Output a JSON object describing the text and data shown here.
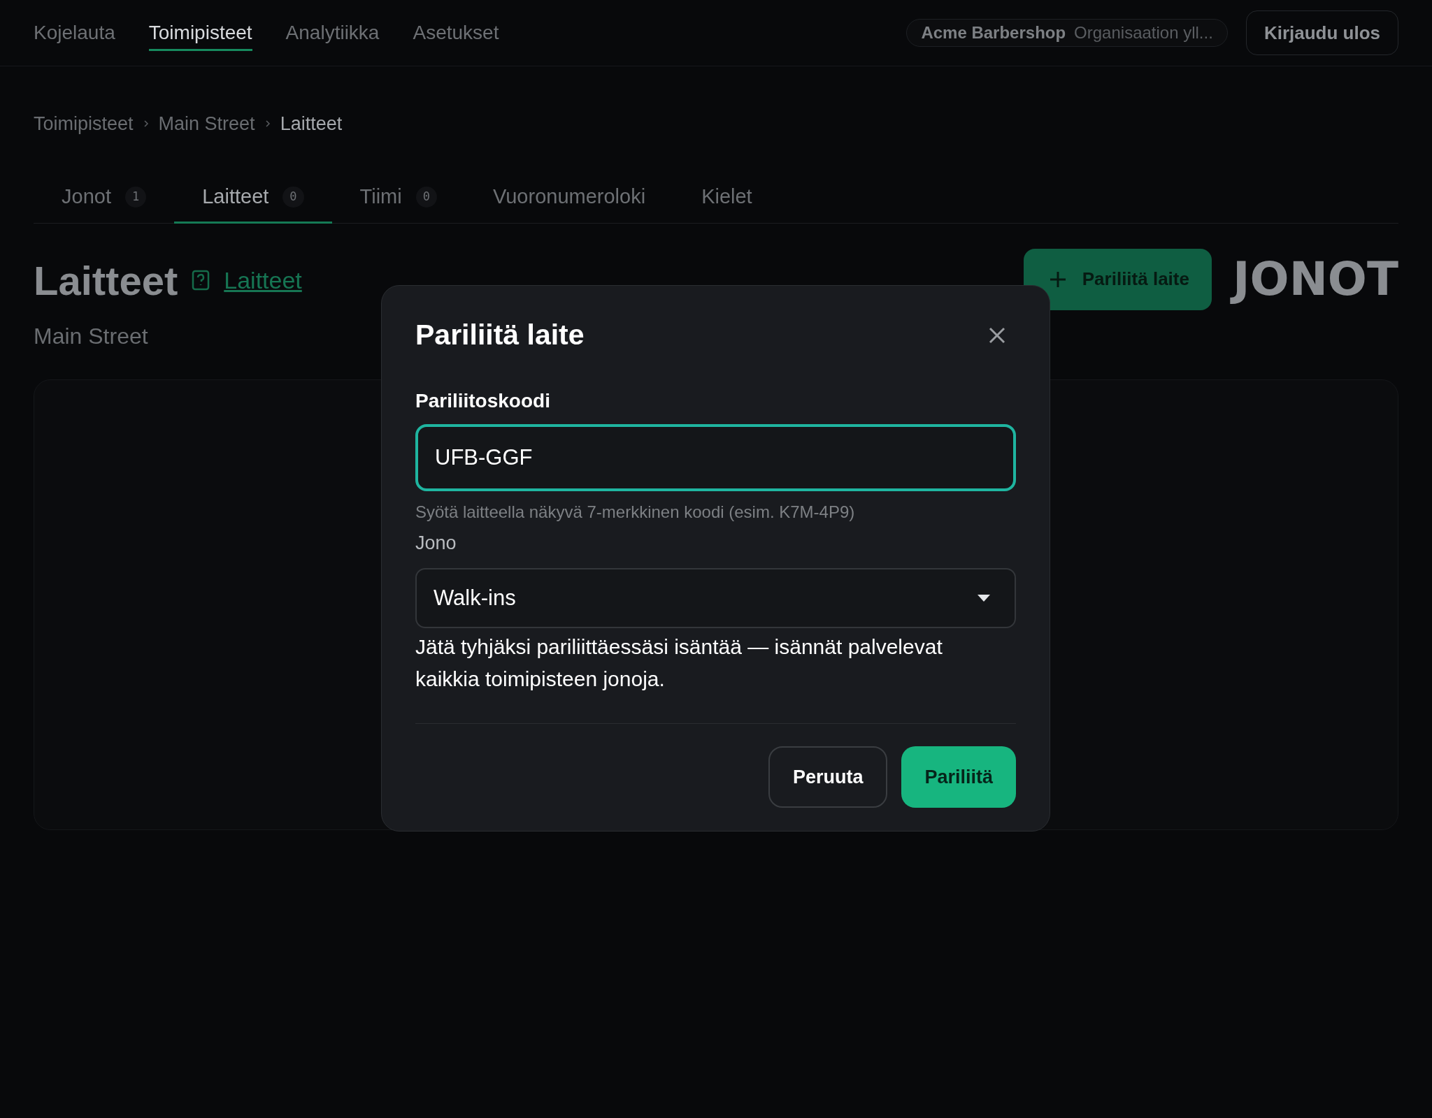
{
  "nav": {
    "items": [
      {
        "label": "Kojelauta",
        "selected": false
      },
      {
        "label": "Toimipisteet",
        "selected": true
      },
      {
        "label": "Analytiikka",
        "selected": false
      },
      {
        "label": "Asetukset",
        "selected": false
      }
    ],
    "org": {
      "name": "Acme Barbershop",
      "role": "Organisaation yll..."
    },
    "logout": "Kirjaudu ulos"
  },
  "breadcrumbs": [
    "Toimipisteet",
    "Main Street",
    "Laitteet"
  ],
  "tabs": [
    {
      "label": "Jonot",
      "count": "1",
      "selected": false
    },
    {
      "label": "Laitteet",
      "count": "0",
      "selected": true
    },
    {
      "label": "Tiimi",
      "count": "0",
      "selected": false
    },
    {
      "label": "Vuoronumeroloki",
      "selected": false
    },
    {
      "label": "Kielet",
      "selected": false
    }
  ],
  "header": {
    "title": "Laitteet",
    "help_link": "Laitteet",
    "subtitle": "Main Street",
    "action": "Pariliitä laite",
    "logo": "JONOT"
  },
  "dialog": {
    "title": "Pariliitä laite",
    "code_label": "Pariliitoskoodi",
    "code_value": "UFB-GGF",
    "code_hint": "Syötä laitteella näkyvä 7-merkkinen koodi (esim. K7M-4P9)",
    "queue_label": "Jono",
    "queue_value": "Walk-ins",
    "queue_help": "Jätä tyhjäksi pariliittäessäsi isäntää — isännät palvelevat kaikkia toimipisteen jonoja.",
    "cancel": "Peruuta",
    "confirm": "Pariliitä"
  }
}
